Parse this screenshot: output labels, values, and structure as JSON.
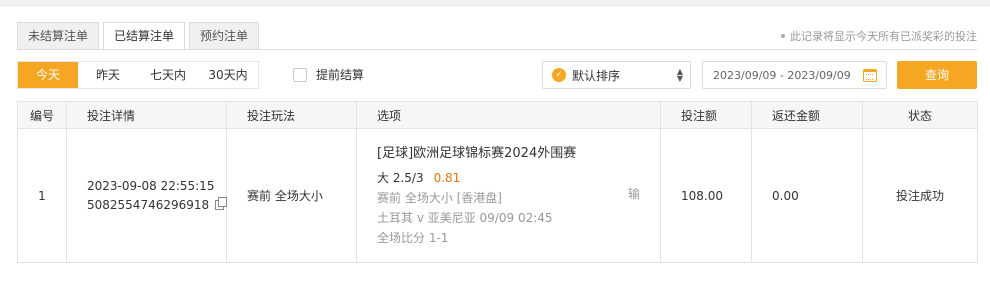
{
  "tabs": [
    {
      "label": "未结算注单",
      "active": false
    },
    {
      "label": "已结算注单",
      "active": true
    },
    {
      "label": "预约注单",
      "active": false
    }
  ],
  "note": "此记录将显示今天所有已派奖彩的投注",
  "filters": [
    {
      "label": "今天",
      "active": true
    },
    {
      "label": "昨天",
      "active": false
    },
    {
      "label": "七天内",
      "active": false
    },
    {
      "label": "30天内",
      "active": false
    }
  ],
  "early_settle": {
    "label": "提前结算",
    "checked": false
  },
  "sort": {
    "label": "默认排序"
  },
  "date_range": "2023/09/09 - 2023/09/09",
  "query_label": "查询",
  "colors": {
    "accent": "#f5a623",
    "odds": "#e8740c"
  },
  "table": {
    "headers": [
      "编号",
      "投注详情",
      "投注玩法",
      "选项",
      "投注额",
      "返还金额",
      "状态"
    ],
    "rows": [
      {
        "no": "1",
        "time": "2023-09-08 22:55:15",
        "order_id": "5082554746296918",
        "play": "赛前 全场大小",
        "option": {
          "title": "[足球]欧洲足球锦标赛2024外围赛",
          "pick": "大 2.5/3",
          "odds": "0.81",
          "market": "赛前   全场大小   [香港盘]",
          "teams": "土耳其 v 亚美尼亚    09/09 02:45",
          "score": "全场比分 1-1",
          "result": "输"
        },
        "amount": "108.00",
        "returned": "0.00",
        "status": "投注成功"
      }
    ]
  }
}
